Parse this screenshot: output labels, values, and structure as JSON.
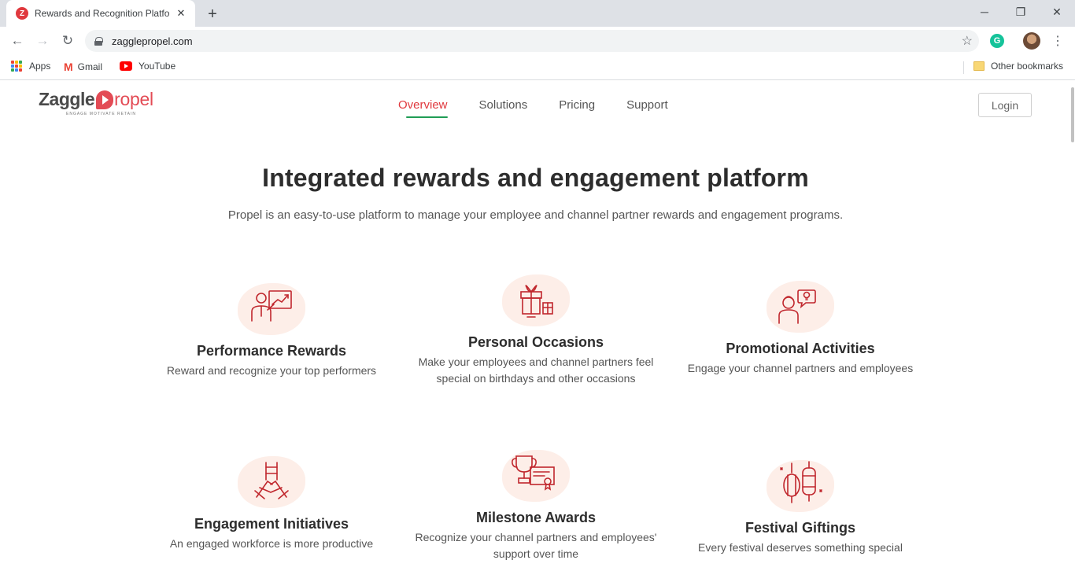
{
  "browser": {
    "tab_title": "Rewards and Recognition Platform",
    "tab_favicon": "Z",
    "url": "zagglepropel.com",
    "bookmarks": [
      {
        "label": "Apps",
        "icon": "apps-grid-icon"
      },
      {
        "label": "Gmail",
        "icon": "gmail-icon"
      },
      {
        "label": "YouTube",
        "icon": "youtube-icon"
      }
    ],
    "other_bookmarks": "Other bookmarks",
    "extension_glyph": "G"
  },
  "site": {
    "logo": {
      "zaggle": "Zaggle",
      "propel": "ropel",
      "tagline": "ENGAGE MOTIVATE RETAIN"
    },
    "nav": [
      {
        "label": "Overview",
        "active": true
      },
      {
        "label": "Solutions",
        "active": false
      },
      {
        "label": "Pricing",
        "active": false
      },
      {
        "label": "Support",
        "active": false
      }
    ],
    "login_label": "Login",
    "accent_color": "#e0393e",
    "nav_underline_color": "#1f9d55"
  },
  "hero": {
    "title": "Integrated rewards and engagement platform",
    "subtitle": "Propel is an easy-to-use platform to manage your employee and channel partner rewards and engagement programs."
  },
  "features": [
    {
      "title": "Performance Rewards",
      "desc": "Reward and recognize your top performers",
      "icon": "presenter-chart-icon"
    },
    {
      "title": "Personal Occasions",
      "desc": "Make your employees and channel partners feel special on birthdays and other occasions",
      "icon": "gift-box-icon"
    },
    {
      "title": "Promotional Activities",
      "desc": "Engage your channel partners and employees",
      "icon": "person-idea-icon"
    },
    {
      "title": "Engagement Initiatives",
      "desc": "An engaged workforce is more productive",
      "icon": "team-hands-icon"
    },
    {
      "title": "Milestone Awards",
      "desc": "Recognize your channel partners and employees' support over time",
      "icon": "trophy-certificate-icon"
    },
    {
      "title": "Festival Giftings",
      "desc": "Every festival deserves something special",
      "icon": "lanterns-icon"
    }
  ]
}
